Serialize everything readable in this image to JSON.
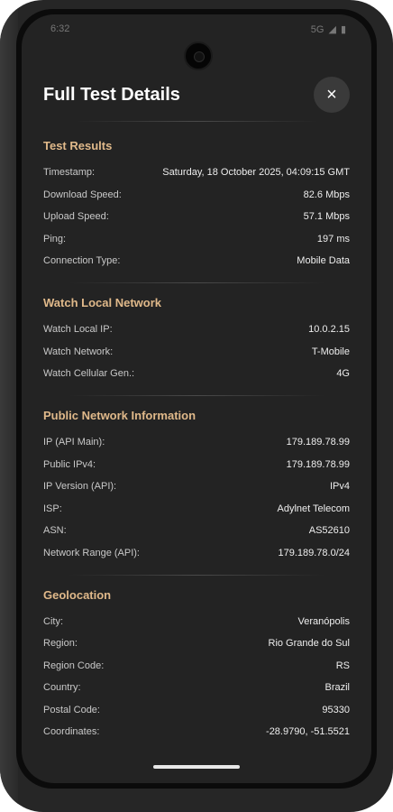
{
  "status": {
    "time": "6:32",
    "network": "5G"
  },
  "header": {
    "title": "Full Test Details",
    "close_icon": "×"
  },
  "sections": [
    {
      "title": "Test Results",
      "rows": [
        {
          "label": "Timestamp:",
          "value": "Saturday, 18 October 2025, 04:09:15 GMT"
        },
        {
          "label": "Download Speed:",
          "value": "82.6 Mbps"
        },
        {
          "label": "Upload Speed:",
          "value": "57.1 Mbps"
        },
        {
          "label": "Ping:",
          "value": "197 ms"
        },
        {
          "label": "Connection Type:",
          "value": "Mobile Data"
        }
      ]
    },
    {
      "title": "Watch Local Network",
      "rows": [
        {
          "label": "Watch Local IP:",
          "value": "10.0.2.15"
        },
        {
          "label": "Watch Network:",
          "value": "T-Mobile"
        },
        {
          "label": "Watch Cellular Gen.:",
          "value": "4G"
        }
      ]
    },
    {
      "title": "Public Network Information",
      "rows": [
        {
          "label": "IP (API Main):",
          "value": "179.189.78.99"
        },
        {
          "label": "Public IPv4:",
          "value": "179.189.78.99"
        },
        {
          "label": "IP Version (API):",
          "value": "IPv4"
        },
        {
          "label": "ISP:",
          "value": "Adylnet Telecom"
        },
        {
          "label": "ASN:",
          "value": "AS52610"
        },
        {
          "label": "Network Range (API):",
          "value": "179.189.78.0/24"
        }
      ]
    },
    {
      "title": "Geolocation",
      "rows": [
        {
          "label": "City:",
          "value": "Veranópolis"
        },
        {
          "label": "Region:",
          "value": "Rio Grande do Sul"
        },
        {
          "label": "Region Code:",
          "value": "RS"
        },
        {
          "label": "Country:",
          "value": "Brazil"
        },
        {
          "label": "Postal Code:",
          "value": "95330"
        },
        {
          "label": "Coordinates:",
          "value": "-28.9790, -51.5521"
        }
      ]
    }
  ]
}
